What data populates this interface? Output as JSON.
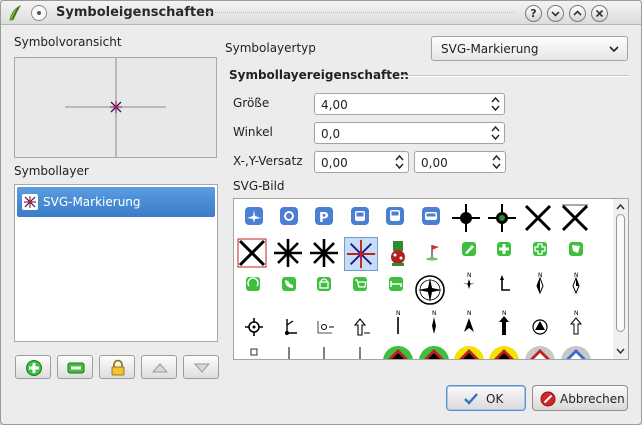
{
  "window": {
    "title": "Symboleigenschaften",
    "buttons": [
      "?",
      "⌄",
      "⌃",
      "✕"
    ]
  },
  "left": {
    "preview_label": "Symbolvoransicht",
    "layers_label": "Symbollayer",
    "layers": [
      {
        "label": "SVG-Markierung",
        "selected": true
      }
    ],
    "buttons": [
      "add-layer",
      "remove-layer",
      "lock-layer",
      "move-up",
      "move-down"
    ]
  },
  "right": {
    "layertype_label": "Symbolayertyp",
    "layertype_value": "SVG-Markierung",
    "props_title": "Symbollayereigenschaften",
    "size_label": "Größe",
    "size_value": "4,00",
    "angle_label": "Winkel",
    "angle_value": "0,0",
    "offset_label": "X-,Y-Versatz",
    "offset_x": "0,00",
    "offset_y": "0,00",
    "svg_label": "SVG-Bild"
  },
  "svg_images": [
    "airport-icon",
    "pharmacy-icon",
    "parking-icon",
    "bus-icon",
    "tram-icon",
    "train-icon",
    "cross-circles-icon",
    "cross-circle-dot-icon",
    "x-marker-icon",
    "x-square-marker-icon",
    "x-box-icon",
    "asterisk-icon",
    "asterisk-icon-2",
    "asterisk-selected-icon",
    "hazard-icon",
    "flag-icon",
    "recycle-icon",
    "phone-icon",
    "shopping-icon",
    "cart-icon",
    "bed-icon",
    "compass-rose-icon",
    "windrose-icon",
    "north-arrow-icon",
    "north-star-icon",
    "north-star-icon-2"
  ],
  "actions": {
    "ok": "OK",
    "cancel": "Abbrechen"
  },
  "colors": {
    "selection": "#3a7cc8",
    "accent_green": "#3fbf3f"
  }
}
